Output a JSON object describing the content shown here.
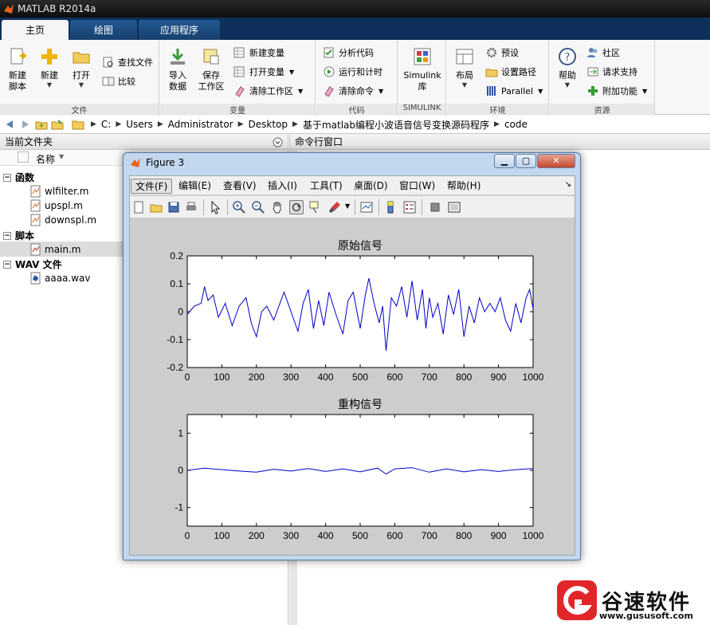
{
  "app": {
    "title": "MATLAB R2014a"
  },
  "tabs": [
    "主页",
    "绘图",
    "应用程序"
  ],
  "ribbon": {
    "file_group": {
      "label": "文件",
      "new_script": "新建\n脚本",
      "new": "新建",
      "open": "打开",
      "find_files": "查找文件",
      "compare": "比较"
    },
    "variable_group": {
      "label": "变量",
      "import": "导入\n数据",
      "save_workspace": "保存\n工作区",
      "new_variable": "新建变量",
      "open_variable": "打开变量",
      "clear_workspace": "清除工作区"
    },
    "code_group": {
      "label": "代码",
      "analyze": "分析代码",
      "run_time": "运行和计时",
      "clear_commands": "清除命令"
    },
    "simulink_group": {
      "label": "SIMULINK",
      "simulink": "Simulink\n库"
    },
    "env_group": {
      "label": "环境",
      "layout": "布局",
      "preferences": "预设",
      "set_path": "设置路径",
      "parallel": "Parallel"
    },
    "resources_group": {
      "label": "资源",
      "help": "帮助",
      "community": "社区",
      "support": "请求支持",
      "addons": "附加功能"
    }
  },
  "path": [
    "C:",
    "Users",
    "Administrator",
    "Desktop",
    "基于matlab编程小波语音信号变换源码程序",
    "code"
  ],
  "current_folder": {
    "title": "当前文件夹",
    "column": "名称",
    "sections": [
      {
        "label": "函数",
        "files": [
          "wlfilter.m",
          "upspl.m",
          "downspl.m"
        ]
      },
      {
        "label": "脚本",
        "files": [
          "main.m"
        ]
      },
      {
        "label": "WAV 文件",
        "files": [
          "aaaa.wav"
        ]
      }
    ]
  },
  "command_window": {
    "title": "命令行窗口"
  },
  "figure": {
    "title": "Figure 3",
    "menus": [
      "文件(F)",
      "编辑(E)",
      "查看(V)",
      "插入(I)",
      "工具(T)",
      "桌面(D)",
      "窗口(W)",
      "帮助(H)"
    ]
  },
  "chart_data": [
    {
      "type": "line",
      "title": "原始信号",
      "xlabel": "",
      "ylabel": "",
      "xlim": [
        0,
        1000
      ],
      "ylim": [
        -0.2,
        0.2
      ],
      "xticks": [
        0,
        100,
        200,
        300,
        400,
        500,
        600,
        700,
        800,
        900,
        1000
      ],
      "yticks": [
        -0.2,
        -0.1,
        0,
        0.1,
        0.2
      ],
      "ytick_labels": [
        "-0.2",
        "-0.1",
        "0",
        "0.1",
        "0.2"
      ],
      "color": "#0000c8",
      "x": [
        0,
        20,
        40,
        50,
        60,
        75,
        90,
        110,
        130,
        150,
        170,
        185,
        200,
        215,
        230,
        250,
        265,
        280,
        300,
        320,
        335,
        350,
        365,
        380,
        395,
        410,
        430,
        450,
        465,
        480,
        500,
        515,
        525,
        540,
        555,
        565,
        575,
        590,
        605,
        620,
        635,
        650,
        665,
        680,
        690,
        700,
        710,
        725,
        740,
        755,
        770,
        785,
        800,
        815,
        830,
        845,
        860,
        875,
        890,
        905,
        920,
        935,
        950,
        965,
        980,
        990,
        1000
      ],
      "y": [
        -0.01,
        0.02,
        0.03,
        0.09,
        0.04,
        0.06,
        -0.02,
        0.03,
        -0.05,
        0.02,
        0.05,
        -0.04,
        -0.09,
        0.0,
        0.02,
        -0.03,
        0.02,
        0.07,
        0.0,
        -0.07,
        0.03,
        0.08,
        -0.06,
        0.04,
        -0.05,
        0.07,
        -0.01,
        -0.08,
        0.04,
        0.07,
        -0.06,
        0.06,
        0.12,
        0.03,
        -0.04,
        0.02,
        -0.14,
        0.05,
        0.02,
        0.09,
        -0.02,
        0.11,
        -0.03,
        0.08,
        -0.06,
        0.05,
        -0.02,
        0.03,
        -0.08,
        0.06,
        -0.01,
        0.08,
        -0.09,
        0.02,
        -0.04,
        0.05,
        0.0,
        0.03,
        0.0,
        0.05,
        -0.03,
        -0.07,
        0.03,
        -0.04,
        0.05,
        0.08,
        0.01
      ]
    },
    {
      "type": "line",
      "title": "重构信号",
      "xlabel": "",
      "ylabel": "",
      "xlim": [
        0,
        1000
      ],
      "ylim": [
        -1.5,
        1.5
      ],
      "xticks": [
        0,
        100,
        200,
        300,
        400,
        500,
        600,
        700,
        800,
        900,
        1000
      ],
      "yticks": [
        -1,
        0,
        1
      ],
      "ytick_labels": [
        "-1",
        "0",
        "1"
      ],
      "color": "#0000c8",
      "x": [
        0,
        50,
        100,
        150,
        200,
        250,
        300,
        350,
        400,
        450,
        500,
        550,
        575,
        600,
        650,
        700,
        750,
        800,
        850,
        900,
        950,
        1000
      ],
      "y": [
        0.0,
        0.06,
        0.02,
        -0.02,
        -0.05,
        0.03,
        -0.02,
        0.05,
        -0.03,
        0.04,
        -0.04,
        0.06,
        -0.1,
        0.04,
        0.07,
        -0.05,
        0.04,
        -0.04,
        0.02,
        -0.03,
        0.02,
        0.05
      ]
    }
  ],
  "watermark": {
    "text": "谷速软件",
    "url": "www.gususoft.com"
  }
}
